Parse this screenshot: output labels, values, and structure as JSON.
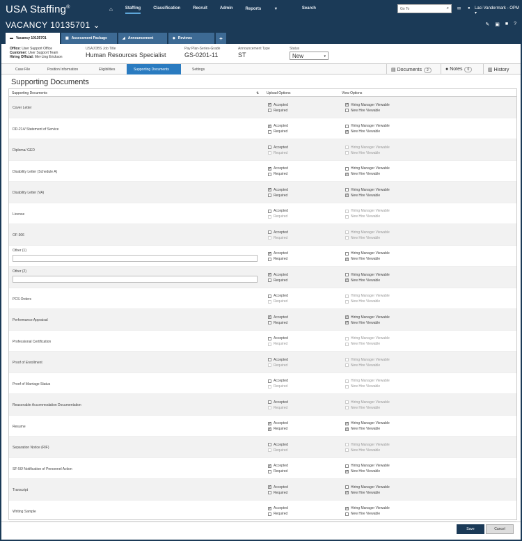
{
  "app": {
    "logo": "USA Staffing",
    "logo_mark": "®"
  },
  "nav": {
    "items": [
      "Staffing",
      "Classification",
      "Recruit",
      "Admin",
      "Reports",
      "Search"
    ],
    "active": "Staffing",
    "reports_arrow": "▾"
  },
  "search": {
    "placeholder": "Go To"
  },
  "user": {
    "name": "Laci Vandermark - OPM"
  },
  "vacancy": {
    "title": "VACANCY 10135701",
    "caret": "⌄"
  },
  "tabs": [
    {
      "label": "Vacancy 10135701",
      "icon": "case-icon"
    },
    {
      "label": "Assessment Package",
      "icon": "package-icon"
    },
    {
      "label": "Announcement",
      "icon": "megaphone-icon"
    },
    {
      "label": "Reviews",
      "icon": "thumbs-up-icon"
    },
    {
      "label": "+"
    }
  ],
  "info": {
    "office_label": "Office:",
    "office": "User Support Office",
    "customer_label": "Customer:",
    "customer": "User Support Team",
    "hiring_label": "Hiring Official:",
    "hiring": "Mei-Ling Erickson"
  },
  "meta": {
    "job_title_label": "USAJOBS Job Title",
    "job_title": "Human Resources Specialist",
    "grade_label": "Pay Plan-Series-Grade",
    "grade": "GS-0201-11",
    "ann_type_label": "Announcement Type",
    "ann_type": "ST",
    "status_label": "Status",
    "status": "New"
  },
  "breadcrumb": [
    "Case File",
    "Position Information",
    "Eligibilities",
    "Supporting Documents",
    "Settings"
  ],
  "breadcrumb_active": 3,
  "right_tabs": {
    "documents": "Documents",
    "documents_count": "2",
    "notes": "Notes",
    "notes_count": "0",
    "history": "History"
  },
  "section_title": "Supporting Documents",
  "columns": {
    "doc": "Supporting Documents",
    "upload": "Upload Options",
    "view": "View Options",
    "sort": "⇅"
  },
  "labels": {
    "accepted": "Accepted",
    "required": "Required",
    "hm": "Hiring Manager Viewable",
    "nh": "New Hire Viewable"
  },
  "rows": [
    {
      "name": "Cover Letter",
      "acc": true,
      "req": false,
      "hm": true,
      "nh": false,
      "hmDis": false,
      "nhDis": false,
      "reqDis": false
    },
    {
      "name": "DD-214/ Statement of Service",
      "acc": true,
      "req": false,
      "hm": false,
      "nh": true,
      "hmDis": false,
      "nhDis": false,
      "reqDis": false
    },
    {
      "name": "Diploma/ GED",
      "acc": false,
      "req": false,
      "hm": false,
      "nh": false,
      "hmDis": true,
      "nhDis": true,
      "reqDis": true
    },
    {
      "name": "Disability Letter (Schedule A)",
      "acc": true,
      "req": false,
      "hm": false,
      "nh": true,
      "hmDis": false,
      "nhDis": false,
      "reqDis": false
    },
    {
      "name": "Disability Letter (VA)",
      "acc": true,
      "req": false,
      "hm": false,
      "nh": true,
      "hmDis": false,
      "nhDis": false,
      "reqDis": false
    },
    {
      "name": "License",
      "acc": false,
      "req": false,
      "hm": false,
      "nh": false,
      "hmDis": true,
      "nhDis": true,
      "reqDis": true
    },
    {
      "name": "OF-306",
      "acc": false,
      "req": false,
      "hm": false,
      "nh": false,
      "hmDis": true,
      "nhDis": true,
      "reqDis": true
    },
    {
      "name": "Other (1)",
      "acc": true,
      "req": false,
      "hm": false,
      "nh": true,
      "hmDis": false,
      "nhDis": false,
      "reqDis": false,
      "input": true
    },
    {
      "name": "Other (2)",
      "acc": true,
      "req": false,
      "hm": false,
      "nh": true,
      "hmDis": false,
      "nhDis": false,
      "reqDis": false,
      "input": true
    },
    {
      "name": "PCS Orders",
      "acc": false,
      "req": false,
      "hm": false,
      "nh": false,
      "hmDis": true,
      "nhDis": true,
      "reqDis": true
    },
    {
      "name": "Performance Appraisal",
      "acc": true,
      "req": false,
      "hm": true,
      "nh": true,
      "hmDis": false,
      "nhDis": false,
      "reqDis": false
    },
    {
      "name": "Professional Certification",
      "acc": false,
      "req": false,
      "hm": false,
      "nh": false,
      "hmDis": true,
      "nhDis": true,
      "reqDis": true
    },
    {
      "name": "Proof of Enrollment",
      "acc": false,
      "req": false,
      "hm": false,
      "nh": false,
      "hmDis": true,
      "nhDis": true,
      "reqDis": true
    },
    {
      "name": "Proof of Marriage Status",
      "acc": false,
      "req": false,
      "hm": false,
      "nh": false,
      "hmDis": true,
      "nhDis": true,
      "reqDis": true
    },
    {
      "name": "Reasonable Accommodation Documentation",
      "acc": false,
      "req": false,
      "hm": false,
      "nh": false,
      "hmDis": true,
      "nhDis": true,
      "reqDis": true
    },
    {
      "name": "Resume",
      "acc": true,
      "req": true,
      "hm": true,
      "nh": true,
      "hmDis": false,
      "nhDis": false,
      "reqDis": false
    },
    {
      "name": "Separation Notice (RIF)",
      "acc": false,
      "req": false,
      "hm": false,
      "nh": false,
      "hmDis": true,
      "nhDis": true,
      "reqDis": true
    },
    {
      "name": "SF-50/ Notification of Personnel Action",
      "acc": true,
      "req": false,
      "hm": false,
      "nh": true,
      "hmDis": false,
      "nhDis": false,
      "reqDis": false
    },
    {
      "name": "Transcript",
      "acc": true,
      "req": false,
      "hm": false,
      "nh": true,
      "hmDis": false,
      "nhDis": false,
      "reqDis": false
    },
    {
      "name": "Writing Sample",
      "acc": true,
      "req": false,
      "hm": true,
      "nh": false,
      "hmDis": false,
      "nhDis": false,
      "reqDis": false
    }
  ],
  "footer": {
    "save": "Save",
    "cancel": "Cancel"
  }
}
